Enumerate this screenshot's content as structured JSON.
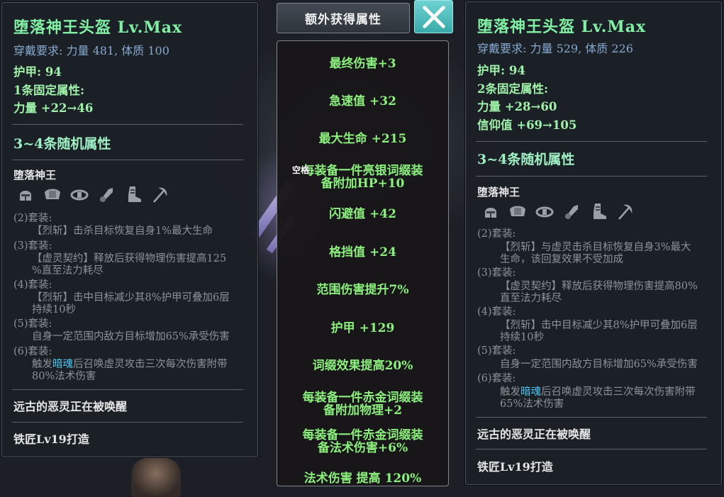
{
  "left": {
    "title": "堕落神王头盔  Lv.Max",
    "requirement": "穿戴要求: 力量 481, 体质 100",
    "armor": "护甲:   94",
    "fixed_header": "1条固定属性:",
    "fixed_attrs": [
      "力量  +22→46"
    ],
    "random_header": "3~4条随机属性",
    "set_name": "堕落神王",
    "set_icons": [
      "helmet-icon",
      "shoulder-armor-icon",
      "belt-icon",
      "gauntlet-icon",
      "boots-icon",
      "pickaxe-icon"
    ],
    "set_bonuses": [
      {
        "label": "(2)套装:",
        "text": [
          "【烈斩】击杀目标恢复自身1%最大生命"
        ]
      },
      {
        "label": "(3)套装:",
        "text": [
          "【虚灵契约】释放后获得物理伤害提高125",
          "%直至法力耗尽"
        ]
      },
      {
        "label": "(4)套装:",
        "text": [
          "【烈斩】击中目标减少其8%护甲可叠加6层",
          "持续10秒"
        ]
      },
      {
        "label": "(5)套装:",
        "text": [
          "自身一定范围内敌方目标增加65%承受伤害"
        ]
      },
      {
        "label": "(6)套装:",
        "pre": "触发",
        "highlight": "暗魂",
        "post": "后召唤虚灵攻击三次每次伤害附带",
        "line2": "80%法术伤害"
      }
    ],
    "flavor": "远古的恶灵正在被唤醒",
    "crafted_by": "铁匠Lv19打造"
  },
  "right": {
    "title": "堕落神王头盔  Lv.Max",
    "requirement": "穿戴要求: 力量 529, 体质 226",
    "armor": "护甲:   94",
    "fixed_header": "2条固定属性:",
    "fixed_attrs": [
      "力量  +28→60",
      "信仰值  +69→105"
    ],
    "random_header": "3~4条随机属性",
    "set_name": "堕落神王",
    "set_icons": [
      "helmet-icon",
      "shoulder-armor-icon",
      "belt-icon",
      "gauntlet-icon",
      "boots-icon",
      "pickaxe-icon"
    ],
    "set_bonuses": [
      {
        "label": "(2)套装:",
        "text": [
          "【烈斩】与虚灵击杀目标恢复自身3%最大",
          "生命，该回复效果不受加成"
        ]
      },
      {
        "label": "(3)套装:",
        "text": [
          "【虚灵契约】释放后获得物理伤害提高80%",
          "直至法力耗尽"
        ]
      },
      {
        "label": "(4)套装:",
        "text": [
          "【烈斩】击中目标减少其8%护甲可叠加6层",
          "持续10秒"
        ]
      },
      {
        "label": "(5)套装:",
        "text": [
          "自身一定范围内敌方目标增加65%承受伤害"
        ]
      },
      {
        "label": "(6)套装:",
        "pre": "触发",
        "highlight": "暗魂",
        "post": "后召唤虚灵攻击三次每次伤害附带",
        "line2": "65%法术伤害"
      }
    ],
    "flavor": "远古的恶灵正在被唤醒",
    "crafted_by": "铁匠Lv19打造"
  },
  "center": {
    "header": "额外获得属性",
    "close_icon": "close-icon",
    "overlay_key": "空格",
    "items": [
      [
        "最终伤害+3"
      ],
      [
        "急速值  +32"
      ],
      [
        "最大生命  +215"
      ],
      [
        "每装备一件亮银词缀装",
        "备附加HP+10"
      ],
      [
        "闪避值  +42"
      ],
      [
        "格挡值  +24"
      ],
      [
        "范围伤害提升7%"
      ],
      [
        "护甲  +129"
      ],
      [
        "词缀效果提高20%"
      ],
      [
        "每装备一件赤金词缀装",
        "备附加物理+2"
      ],
      [
        "每装备一件赤金词缀装",
        "备法术伤害+6%"
      ],
      [
        "法术伤害  提高  120%"
      ]
    ]
  },
  "colors": {
    "title_green": "#82f0a4",
    "attr_green": "#9ff0a8",
    "requirement_blue": "#86a9cf",
    "center_item_green": "#8cf07e",
    "highlight_cyan": "#4bc8f5",
    "close_teal": "#4fbfbf"
  }
}
